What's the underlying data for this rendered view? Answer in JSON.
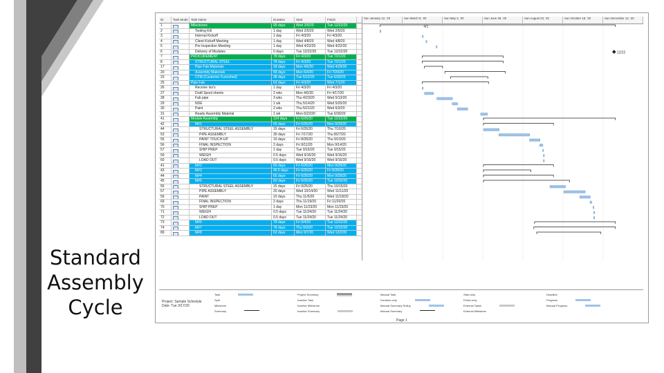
{
  "slide": {
    "title_lines": [
      "Standard",
      "Assembly",
      "Cycle"
    ]
  },
  "columns": {
    "id": "ID",
    "mode": "Task Mode",
    "name": "Task Name",
    "duration": "Duration",
    "start": "Start",
    "finish": "Finish"
  },
  "timeline_headers": [
    "Sun January 12, '20",
    "Sun March 8, '20",
    "Sun May 3, '20",
    "Sun June 28, '20",
    "Sun August 23, '20",
    "Sun October 18, '20",
    "Sun December 13, '20"
  ],
  "tasks": [
    {
      "id": "1",
      "name": "Milestones",
      "dur": "99 days",
      "start": "Wed 2/5/20",
      "fin": "Tue 12/22/20",
      "style": "green",
      "indent": 0
    },
    {
      "id": "2",
      "name": "Tooling Kill",
      "dur": "1 day",
      "start": "Wed 2/5/20",
      "fin": "Wed 2/5/20",
      "style": "",
      "indent": 1
    },
    {
      "id": "3",
      "name": "Internal Kickoff",
      "dur": "1 day",
      "start": "Fri 4/3/20",
      "fin": "Fri 4/3/20",
      "style": "",
      "indent": 1
    },
    {
      "id": "4",
      "name": "Client Kickoff Meeting",
      "dur": "1 day",
      "start": "Wed 4/8/20",
      "fin": "Wed 4/8/20",
      "style": "",
      "indent": 1
    },
    {
      "id": "5",
      "name": "Pre Inspection Meeting",
      "dur": "1 day",
      "start": "Wed 4/22/20",
      "fin": "Wed 4/22/20",
      "style": "",
      "indent": 1
    },
    {
      "id": "6",
      "name": "Delivery of Modules",
      "dur": "0 days",
      "start": "Tue 12/22/20",
      "fin": "Tue 12/22/20",
      "style": "",
      "indent": 1
    },
    {
      "id": "7",
      "name": "PROCUREMENT",
      "dur": "78 days",
      "start": "Fri 4/3/20",
      "fin": "Tue 7/21/20",
      "style": "green",
      "indent": 0
    },
    {
      "id": "8",
      "name": "STRUCTURAL STEEL",
      "dur": "78 days",
      "start": "Fri 4/3/20",
      "fin": "Tue 7/21/20",
      "style": "blue",
      "indent": 1
    },
    {
      "id": "17",
      "name": "Pipe Fab Materials",
      "dur": "18 days",
      "start": "Mon 4/6/20",
      "fin": "Wed 4/29/20",
      "style": "blue",
      "indent": 1
    },
    {
      "id": "20",
      "name": "Assembly Materials",
      "dur": "58 days",
      "start": "Mon 5/4/20",
      "fin": "Fri 7/24/20",
      "style": "blue",
      "indent": 1
    },
    {
      "id": "23",
      "name": "CFM (Customer Furnished)",
      "dur": "38 days",
      "start": "Tue 5/12/20",
      "fin": "Tue 6/30/20",
      "style": "blue",
      "indent": 1
    },
    {
      "id": "25",
      "name": "Pipe Fab",
      "dur": "63 days",
      "start": "Fri 4/3/20",
      "fin": "Wed 7/1/20",
      "style": "blue",
      "indent": 0
    },
    {
      "id": "26",
      "name": "Receive Iso's",
      "dur": "1 day",
      "start": "Fri 4/3/20",
      "fin": "Fri 4/3/20",
      "style": "",
      "indent": 1
    },
    {
      "id": "27",
      "name": "Draft Spool sheets",
      "dur": "2 wks",
      "start": "Mon 4/6/20",
      "fin": "Fri 4/17/20",
      "style": "",
      "indent": 1
    },
    {
      "id": "28",
      "name": "Fab pipe",
      "dur": "3 wks",
      "start": "Thu 4/23/20",
      "fin": "Wed 5/13/20",
      "style": "",
      "indent": 1
    },
    {
      "id": "29",
      "name": "NDE",
      "dur": "1 wk",
      "start": "Thu 5/14/20",
      "fin": "Wed 5/20/20",
      "style": "",
      "indent": 1
    },
    {
      "id": "30",
      "name": "Paint",
      "dur": "2 wks",
      "start": "Thu 5/21/20",
      "fin": "Wed 6/3/20",
      "style": "",
      "indent": 1
    },
    {
      "id": "31",
      "name": "Ready Assembly Material",
      "dur": "1 wk",
      "start": "Mon 6/22/20",
      "fin": "Tue 6/30/20",
      "style": "",
      "indent": 1
    },
    {
      "id": "41",
      "name": "Module Assembly",
      "dur": "124 days",
      "start": "Fri 6/26/20",
      "fin": "Tue 12/22/20",
      "style": "green",
      "indent": 0
    },
    {
      "id": "42",
      "name": "M#1",
      "dur": "65 days",
      "start": "Fri 6/26/20",
      "fin": "Mon 9/28/20",
      "style": "blue",
      "indent": 1
    },
    {
      "id": "44",
      "name": "STRUCTURAL STEEL ASSEMBLY",
      "dur": "15 days",
      "start": "Fri 6/26/20",
      "fin": "Thu 7/16/20",
      "style": "",
      "indent": 2
    },
    {
      "id": "53",
      "name": "PIPE ASSEMBLY",
      "dur": "30 days",
      "start": "Fri 7/17/20",
      "fin": "Thu 8/27/20",
      "style": "",
      "indent": 2
    },
    {
      "id": "55",
      "name": "PAINT TOUCH-UP",
      "dur": "10 days",
      "start": "Fri 8/28/20",
      "fin": "Thu 9/10/20",
      "style": "",
      "indent": 2
    },
    {
      "id": "56",
      "name": "FINAL INSPECTION",
      "dur": "2 days",
      "start": "Fri 9/11/20",
      "fin": "Mon 9/14/20",
      "style": "",
      "indent": 2
    },
    {
      "id": "57",
      "name": "SHIP PREP",
      "dur": "1 day",
      "start": "Tue 9/15/20",
      "fin": "Tue 9/15/20",
      "style": "",
      "indent": 2
    },
    {
      "id": "59",
      "name": "WEIGH",
      "dur": "0.5 days",
      "start": "Wed 9/16/20",
      "fin": "Wed 9/16/20",
      "style": "",
      "indent": 2
    },
    {
      "id": "60",
      "name": "LOAD OUT",
      "dur": "0.5 days",
      "start": "Wed 9/16/20",
      "fin": "Wed 9/16/20",
      "style": "",
      "indent": 2
    },
    {
      "id": "41",
      "name": "M#2",
      "dur": "65 days",
      "start": "Fri 6/26/20",
      "fin": "Mon 9/28/20",
      "style": "blue",
      "indent": 1
    },
    {
      "id": "43",
      "name": "M#3",
      "dur": "45.5 days",
      "start": "Fri 6/26/20",
      "fin": "Fri 8/28/20",
      "style": "blue",
      "indent": 1
    },
    {
      "id": "44",
      "name": "M#4",
      "dur": "65 days",
      "start": "Fri 6/26/20",
      "fin": "Mon 9/28/20",
      "style": "blue",
      "indent": 1
    },
    {
      "id": "45",
      "name": "M#5",
      "dur": "83 days",
      "start": "Fri 6/26/20",
      "fin": "Tue 10/20/20",
      "style": "blue",
      "indent": 1
    },
    {
      "id": "55",
      "name": "STRUCTURAL STEEL ASSEMBLY",
      "dur": "15 days",
      "start": "Fri 9/25/20",
      "fin": "Thu 10/15/20",
      "style": "",
      "indent": 2
    },
    {
      "id": "57",
      "name": "PIPE ASSEMBLY",
      "dur": "20 days",
      "start": "Wed 10/14/20",
      "fin": "Wed 11/11/20",
      "style": "",
      "indent": 2
    },
    {
      "id": "59",
      "name": "PAINT",
      "dur": "10 days",
      "start": "Thu 11/5/20",
      "fin": "Wed 11/18/20",
      "style": "",
      "indent": 2
    },
    {
      "id": "69",
      "name": "FINAL INSPECTION",
      "dur": "2 days",
      "start": "Thu 11/19/20",
      "fin": "Fri 11/20/20",
      "style": "",
      "indent": 2
    },
    {
      "id": "70",
      "name": "SHIP PREP",
      "dur": "1 day",
      "start": "Mon 11/23/20",
      "fin": "Mon 11/23/20",
      "style": "",
      "indent": 2
    },
    {
      "id": "71",
      "name": "WEIGH",
      "dur": "0.5 days",
      "start": "Tue 11/24/20",
      "fin": "Tue 11/24/20",
      "style": "",
      "indent": 2
    },
    {
      "id": "72",
      "name": "LOAD OUT",
      "dur": "0.5 days",
      "start": "Tue 11/24/20",
      "fin": "Tue 11/24/20",
      "style": "",
      "indent": 2
    },
    {
      "id": "73",
      "name": "M#6",
      "dur": "78 days",
      "start": "Fri 9/4/20",
      "fin": "Tue 12/22/20",
      "style": "blue",
      "indent": 1
    },
    {
      "id": "74",
      "name": "M#7",
      "dur": "78 days",
      "start": "Thu 9/3/20",
      "fin": "Tue 12/22/20",
      "style": "blue",
      "indent": 1
    },
    {
      "id": "89",
      "name": "M#8",
      "dur": "63 days",
      "start": "Mon 9/7/20",
      "fin": "Wed 12/2/20",
      "style": "blue",
      "indent": 1
    }
  ],
  "milestone_labels": {
    "first": "4/1",
    "deadline": "12/22"
  },
  "project_info": {
    "line1": "Project: Sample Schedule",
    "line2": "Date: Tue 3/17/20"
  },
  "legend": [
    {
      "label": "Task",
      "kind": "bar"
    },
    {
      "label": "Split",
      "kind": "dots"
    },
    {
      "label": "Milestone",
      "kind": "diamond"
    },
    {
      "label": "Summary",
      "kind": "summary"
    },
    {
      "label": "Project Summary",
      "kind": "psum"
    },
    {
      "label": "Inactive Task",
      "kind": "inactive"
    },
    {
      "label": "Inactive Milestone",
      "kind": "diamond-o"
    },
    {
      "label": "Inactive Summary",
      "kind": "summary-o"
    },
    {
      "label": "Manual Task",
      "kind": "manual"
    },
    {
      "label": "Duration-only",
      "kind": "dur"
    },
    {
      "label": "Manual Summary Rollup",
      "kind": "rollup"
    },
    {
      "label": "Manual Summary",
      "kind": "msum"
    },
    {
      "label": "Start-only",
      "kind": "start"
    },
    {
      "label": "Finish-only",
      "kind": "finish"
    },
    {
      "label": "External Tasks",
      "kind": "ext"
    },
    {
      "label": "External Milestone",
      "kind": "extm"
    },
    {
      "label": "Deadline",
      "kind": "deadline"
    },
    {
      "label": "Progress",
      "kind": "progress"
    },
    {
      "label": "Manual Progress",
      "kind": "mprogress"
    }
  ],
  "footer": {
    "page": "Page 1"
  },
  "colors": {
    "green": "#00b050",
    "blue": "#00b0f0",
    "bar": "#9ec3e6",
    "deco_dark": "#3a3a3a",
    "deco_mid": "#7f7f7f",
    "deco_light": "#bfbfbf"
  }
}
